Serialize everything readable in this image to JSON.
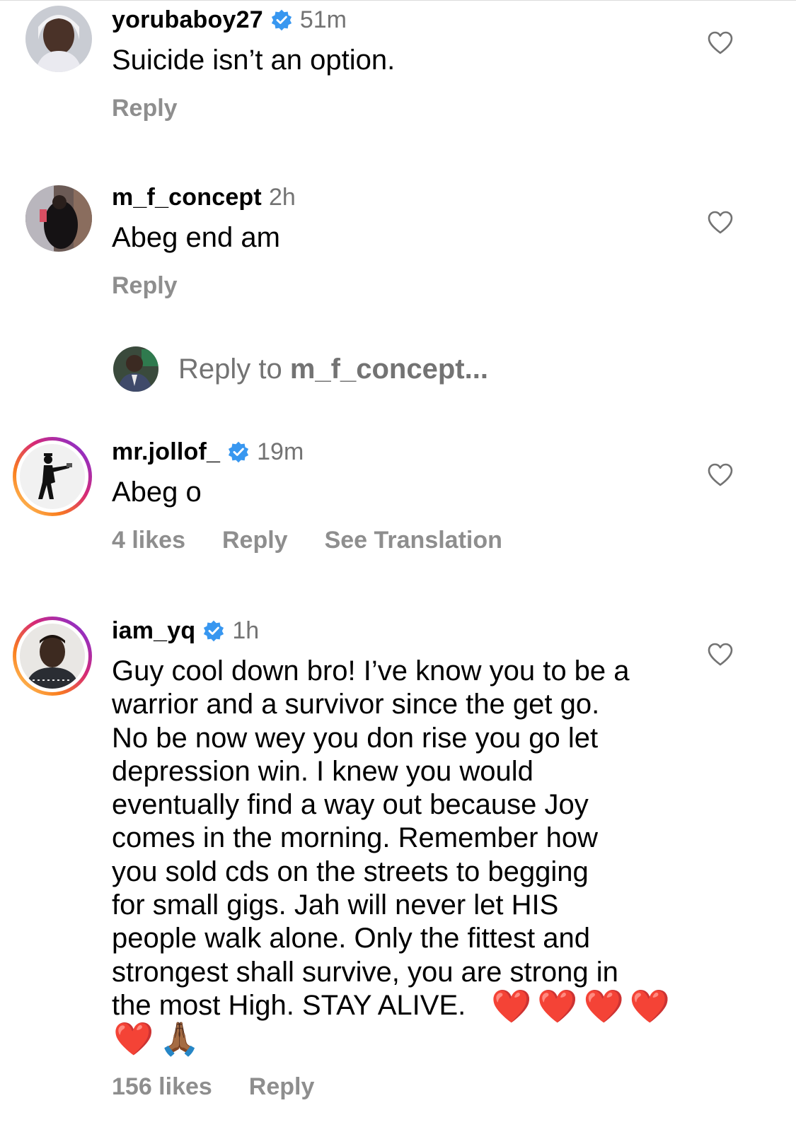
{
  "comments": [
    {
      "username": "yorubaboy27",
      "verified": true,
      "time": "51m",
      "text": "Suicide isn’t an option.",
      "actions": {
        "likes": "",
        "reply": "Reply",
        "translation": ""
      }
    },
    {
      "username": "m_f_concept",
      "verified": false,
      "time": "2h",
      "text": "Abeg end am",
      "actions": {
        "likes": "",
        "reply": "Reply",
        "translation": ""
      }
    },
    {
      "username": "mr.jollof_",
      "verified": true,
      "time": "19m",
      "text": "Abeg o",
      "actions": {
        "likes": "4 likes",
        "reply": "Reply",
        "translation": "See Translation"
      }
    },
    {
      "username": "iam_yq",
      "verified": true,
      "time": "1h",
      "text": "Guy cool down bro! I’ve know you to be a\nwarrior and a survivor since the get go.\nNo be now wey you don rise you go let\ndepression win. I knew you would\neventually find a way out because Joy\ncomes in the morning. Remember how\nyou sold cds on the streets to begging\nfor small gigs. Jah will never let HIS\npeople walk alone. Only the fittest and\nstrongest shall survive, you are strong in\nthe most High. STAY ALIVE.",
      "emoji_inline": [
        "❤️",
        "❤️",
        "❤️",
        "❤️"
      ],
      "emoji_next_line": [
        "❤️",
        "🙏🏾"
      ],
      "actions": {
        "likes": "156 likes",
        "reply": "Reply",
        "translation": ""
      }
    }
  ],
  "reply_compose": {
    "prefix": "Reply to ",
    "target": "m_f_concept..."
  },
  "colors": {
    "secondary_text": "#737373",
    "action_text": "#8e8e8e",
    "verified_blue": "#3897f0",
    "heart_red": "#e0202f"
  }
}
